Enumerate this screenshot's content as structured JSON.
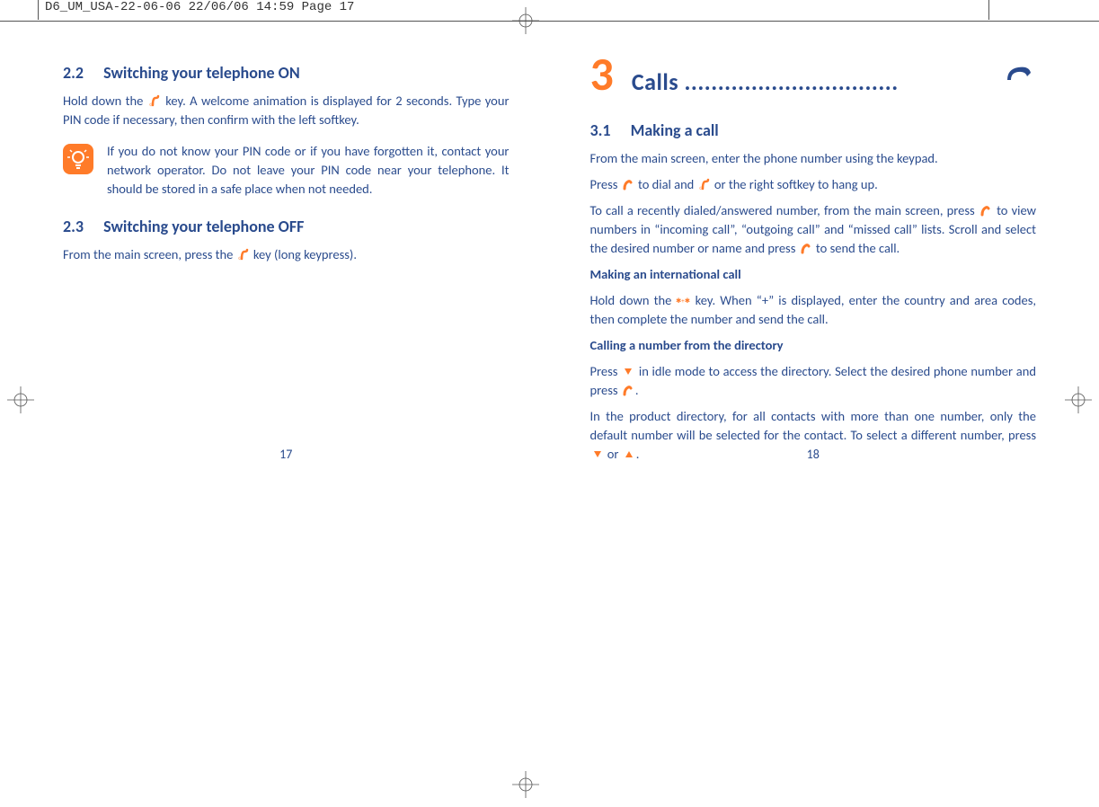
{
  "preprint_slug": "D6_UM_USA-22-06-06  22/06/06  14:59  Page 17",
  "left_page": {
    "section_22_num": "2.2",
    "section_22_title": "Switching your telephone ON",
    "para_22a": "Hold down the ",
    "para_22b": " key. A welcome animation is displayed for 2 seconds. Type your PIN code if necessary, then confirm with the left softkey.",
    "callout_22": "If you do not know your PIN code or if you have forgotten it, contact your network operator. Do not leave your PIN code near your telephone. It should be stored in a safe place when not needed.",
    "section_23_num": "2.3",
    "section_23_title": "Switching your telephone OFF",
    "para_23a": "From the main screen, press the ",
    "para_23b": " key (long keypress).",
    "pageno": "17"
  },
  "right_page": {
    "chapter_num": "3",
    "chapter_title": "Calls ................................",
    "section_31_num": "3.1",
    "section_31_title": "Making a call",
    "para_a": "From the main screen, enter the phone number using the keypad.",
    "para_b1": "Press ",
    "para_b2": " to dial and ",
    "para_b3": " or the right softkey to hang up.",
    "para_c1": "To call a recently dialed/answered number, from the main screen, press ",
    "para_c2": " to view numbers in “incoming call”, “outgoing call” and “missed call” lists. Scroll and select the desired number or name and press ",
    "para_c3": " to send the call.",
    "h_intl": "Making an international call",
    "para_d1": "Hold down the ",
    "para_d2": " key. When “+” is displayed, enter the country and area codes, then complete the number and send the call.",
    "h_dir": "Calling a number from the directory",
    "para_e1": "Press ",
    "para_e2": " in idle mode to access the directory. Select the desired phone number and press ",
    "para_e3": ".",
    "para_f1": "In the product directory, for all contacts with more than one number, only the default number will be selected for the contact. To select a different number, press ",
    "para_f2": " or ",
    "para_f3": ".",
    "pageno": "18"
  }
}
